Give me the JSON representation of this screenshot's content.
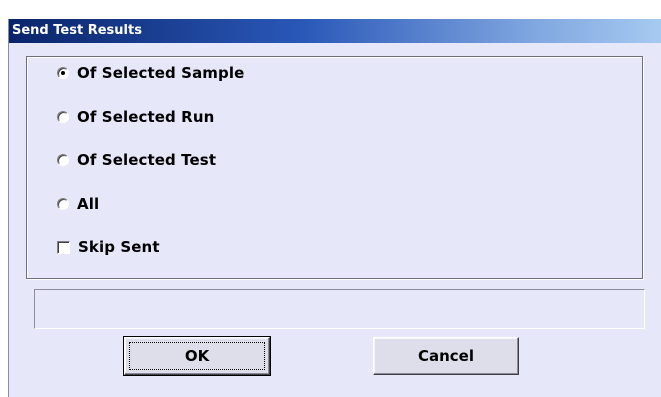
{
  "window": {
    "title": "Send Test Results"
  },
  "options": {
    "of_selected_sample": {
      "label": "Of Selected Sample",
      "checked": true
    },
    "of_selected_run": {
      "label": "Of Selected Run",
      "checked": false
    },
    "of_selected_test": {
      "label": "Of Selected Test",
      "checked": false
    },
    "all": {
      "label": "All",
      "checked": false
    },
    "skip_sent": {
      "label": "Skip Sent",
      "checked": false
    }
  },
  "status": {
    "text": ""
  },
  "buttons": {
    "ok_label": "OK",
    "cancel_label": "Cancel"
  },
  "colors": {
    "dialog_background": "#E7E7FA",
    "titlebar_start": "#0A246A",
    "titlebar_end": "#A6CAF0",
    "title_text": "#FFFFFF"
  }
}
